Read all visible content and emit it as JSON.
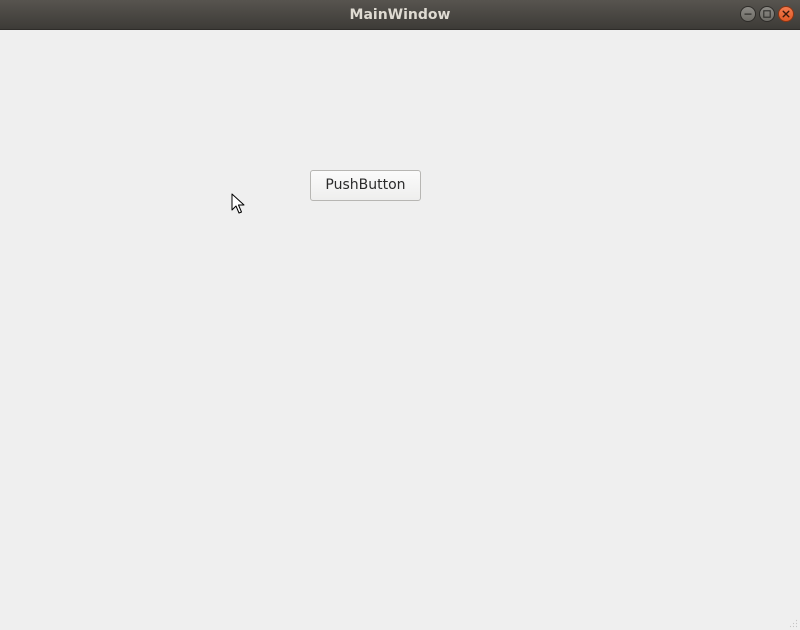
{
  "window": {
    "title": "MainWindow",
    "controls": [
      {
        "name": "minimize",
        "icon": "minimize-icon"
      },
      {
        "name": "maximize",
        "icon": "maximize-icon"
      },
      {
        "name": "close",
        "icon": "close-icon"
      }
    ],
    "accent_close": "#e95420"
  },
  "main": {
    "push_button_label": "PushButton"
  },
  "overlay": {
    "cursor_icon": "mouse-pointer-icon"
  }
}
